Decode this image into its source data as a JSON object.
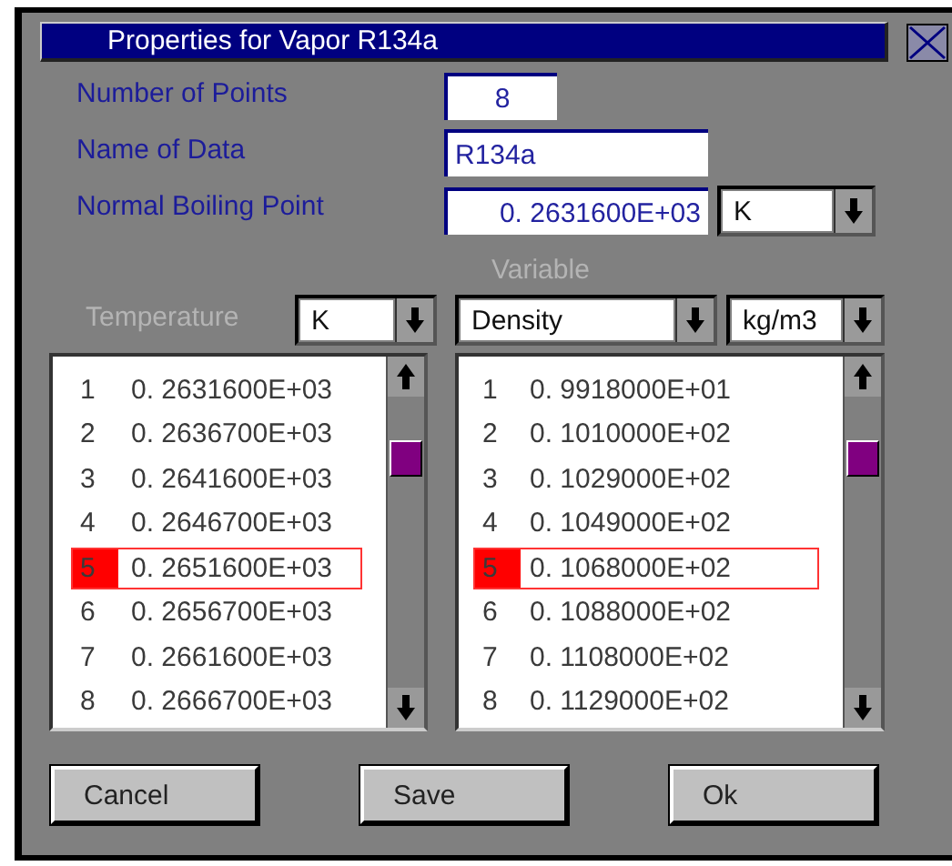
{
  "window": {
    "title": "Properties for Vapor  R134a"
  },
  "fields": [
    {
      "label": "Number of Points",
      "value": "8",
      "kind": "short"
    },
    {
      "label": "Name of Data",
      "value": "R134a",
      "kind": "long"
    },
    {
      "label": "Normal Boiling Point",
      "value": "0. 2631600E+03",
      "kind": "unit",
      "unit": "K"
    }
  ],
  "variable_label": {
    "text": "Variable",
    "disabled": true
  },
  "lists": [
    {
      "label": {
        "text": "Temperature",
        "disabled": true
      },
      "selectors": [
        "K"
      ],
      "rows": [
        {
          "index": "1",
          "value": "0. 2631600E+03",
          "selected": false
        },
        {
          "index": "2",
          "value": "0. 2636700E+03",
          "selected": false
        },
        {
          "index": "3",
          "value": "0. 2641600E+03",
          "selected": false
        },
        {
          "index": "4",
          "value": "0. 2646700E+03",
          "selected": false
        },
        {
          "index": "5",
          "value": "0. 2651600E+03",
          "selected": true
        },
        {
          "index": "6",
          "value": "0. 2656700E+03",
          "selected": false
        },
        {
          "index": "7",
          "value": "0. 2661600E+03",
          "selected": false
        },
        {
          "index": "8",
          "value": "0. 2666700E+03",
          "selected": false
        }
      ]
    },
    {
      "selectors": [
        "Density",
        "kg/m3"
      ],
      "rows": [
        {
          "index": "1",
          "value": "0. 9918000E+01",
          "selected": false
        },
        {
          "index": "2",
          "value": "0. 1010000E+02",
          "selected": false
        },
        {
          "index": "3",
          "value": "0. 1029000E+02",
          "selected": false
        },
        {
          "index": "4",
          "value": "0. 1049000E+02",
          "selected": false
        },
        {
          "index": "5",
          "value": "0. 1068000E+02",
          "selected": true
        },
        {
          "index": "6",
          "value": "0. 1088000E+02",
          "selected": false
        },
        {
          "index": "7",
          "value": "0. 1108000E+02",
          "selected": false
        },
        {
          "index": "8",
          "value": "0. 1129000E+02",
          "selected": false
        }
      ]
    }
  ],
  "buttons": [
    "Cancel",
    "Save",
    "Ok"
  ]
}
